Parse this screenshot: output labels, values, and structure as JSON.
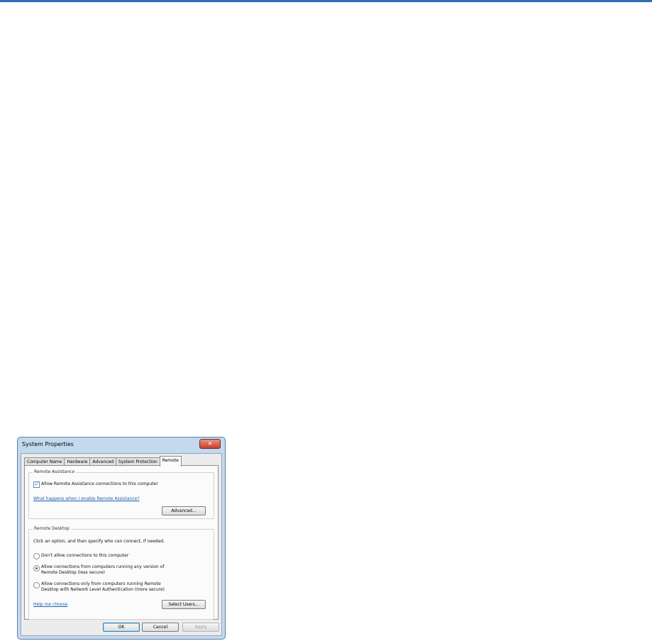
{
  "window": {
    "title": "System Properties",
    "close_label": "✕"
  },
  "tabs": [
    {
      "label": "Computer Name"
    },
    {
      "label": "Hardware"
    },
    {
      "label": "Advanced"
    },
    {
      "label": "System Protection"
    },
    {
      "label": "Remote",
      "active": true
    }
  ],
  "remote_assistance": {
    "group_label": "Remote Assistance",
    "allow_checkbox_label": "Allow Remote Assistance connections to this computer",
    "allow_checked": true,
    "help_link": "What happens when I enable Remote Assistance?",
    "advanced_button": "Advanced..."
  },
  "remote_desktop": {
    "group_label": "Remote Desktop",
    "instructions": "Click an option, and then specify who can connect, if needed.",
    "options": [
      {
        "line1": "Don't allow connections to this computer",
        "line2": "",
        "selected": false
      },
      {
        "line1": "Allow connections from computers running any version of",
        "line2": "Remote Desktop (less secure)",
        "selected": true
      },
      {
        "line1": "Allow connections only from computers running Remote",
        "line2": "Desktop with Network Level Authentication (more secure)",
        "selected": false
      }
    ],
    "help_link": "Help me choose",
    "select_users_button": "Select Users..."
  },
  "footer": {
    "ok": "OK",
    "cancel": "Cancel",
    "apply": "Apply"
  },
  "colors": {
    "accent_rule": "#2f6db5",
    "link": "#1a5fb4",
    "close_button": "#c3402b"
  }
}
